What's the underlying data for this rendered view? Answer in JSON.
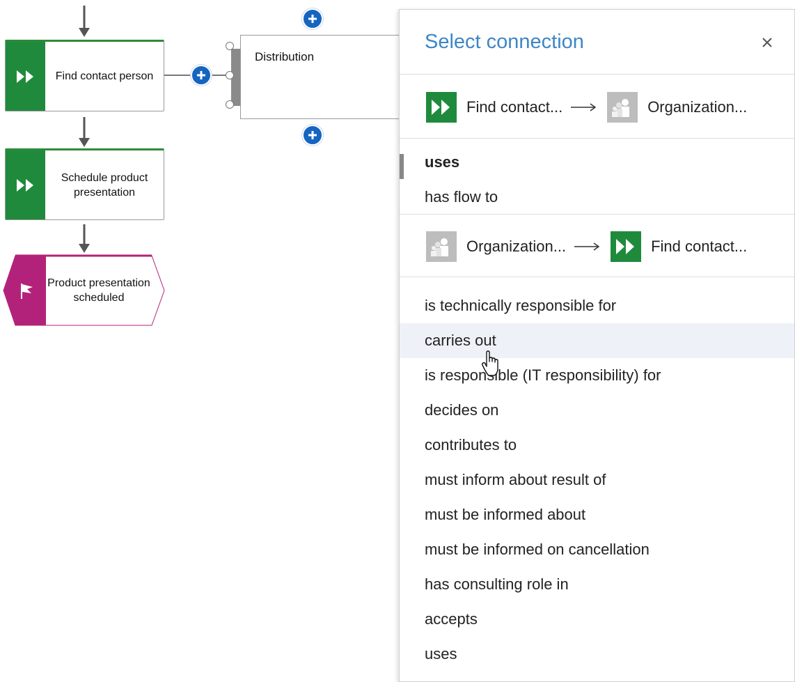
{
  "diagram": {
    "find_contact": "Find contact person",
    "schedule": "Schedule product presentation",
    "event": "Product presentation scheduled",
    "distribution": "Distribution"
  },
  "panel": {
    "title": "Select connection",
    "close_icon": "close-icon",
    "group1": {
      "source": "Find contact...",
      "target": "Organization...",
      "items": [
        "uses",
        "has flow to"
      ],
      "selected": "uses"
    },
    "group2": {
      "source": "Organization...",
      "target": "Find contact...",
      "hovered": "carries out",
      "items": [
        "is technically responsible for",
        "carries out",
        "is responsible (IT responsibility) for",
        "decides on",
        "contributes to",
        "must inform about result of",
        "must be informed about",
        "must be informed on cancellation",
        "has consulting role in",
        "accepts",
        "uses"
      ]
    }
  },
  "colors": {
    "function_green": "#1f8a3c",
    "event_magenta": "#b3227a",
    "accent_blue": "#3d86c6",
    "plus_blue": "#1565c0",
    "hover_bg": "#eef2f8"
  }
}
